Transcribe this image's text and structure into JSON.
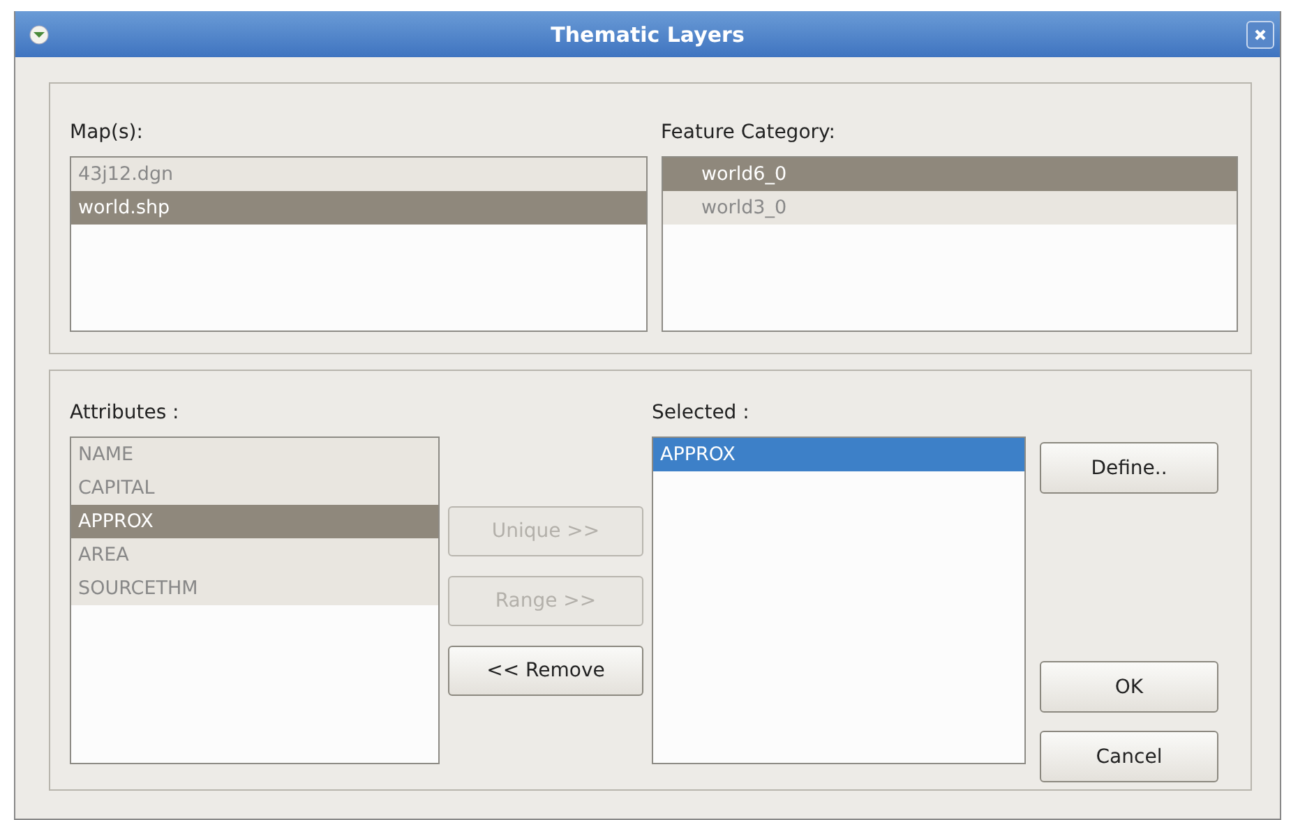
{
  "window": {
    "title": "Thematic Layers"
  },
  "maps": {
    "label": "Map(s):",
    "focused": false,
    "items": [
      {
        "text": "43j12.dgn",
        "selected": false
      },
      {
        "text": "world.shp",
        "selected": true
      }
    ]
  },
  "feature_category": {
    "label": "Feature Category:",
    "focused": false,
    "items": [
      {
        "text": "world6_0",
        "selected": true
      },
      {
        "text": "world3_0",
        "selected": false
      }
    ]
  },
  "attributes": {
    "label": "Attributes :",
    "focused": false,
    "items": [
      {
        "text": "NAME",
        "selected": false
      },
      {
        "text": "CAPITAL",
        "selected": false
      },
      {
        "text": "APPROX",
        "selected": true
      },
      {
        "text": "AREA",
        "selected": false
      },
      {
        "text": "SOURCETHM",
        "selected": false
      }
    ]
  },
  "move_buttons": [
    {
      "label": "Unique >>",
      "disabled": true
    },
    {
      "label": "Range >>",
      "disabled": true
    },
    {
      "label": "<< Remove",
      "disabled": false
    }
  ],
  "selected": {
    "label": "Selected :",
    "focused": true,
    "items": [
      {
        "text": "APPROX",
        "selected": true
      }
    ]
  },
  "side_buttons": [
    {
      "label": "Define..",
      "disabled": false
    }
  ],
  "dialog_buttons": [
    {
      "label": "OK",
      "disabled": false
    },
    {
      "label": "Cancel",
      "disabled": false
    }
  ]
}
